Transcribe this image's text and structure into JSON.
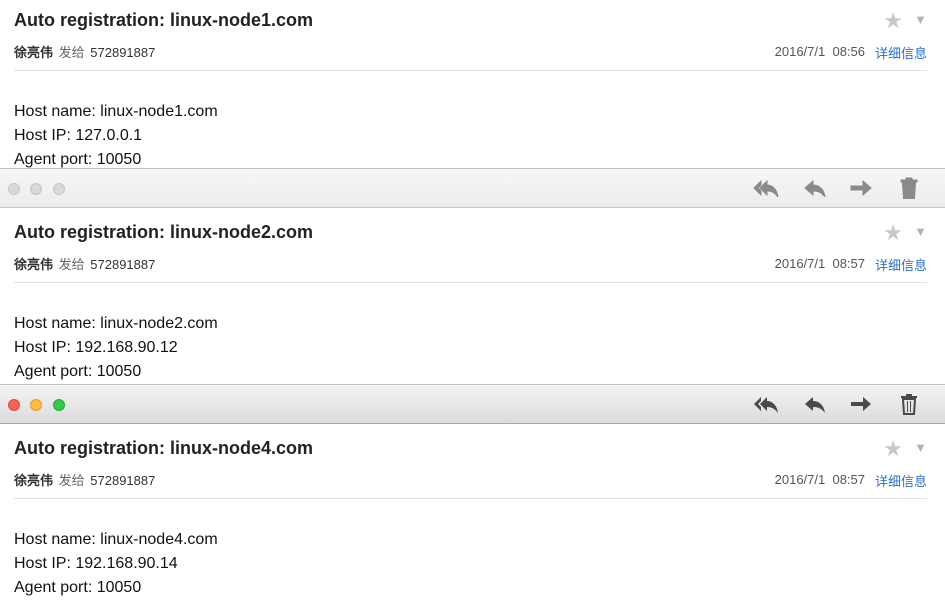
{
  "emails": [
    {
      "subject": "Auto registration: linux-node1.com",
      "sender": "徐亮伟",
      "verb": "发给",
      "recipient": "572891887",
      "date": "2016/7/1  08:56",
      "details_label": "详细信息",
      "lines": [
        "Host name: linux-node1.com",
        "Host IP: 127.0.0.1",
        "Agent port: 10050"
      ]
    },
    {
      "subject": "Auto registration: linux-node2.com",
      "sender": "徐亮伟",
      "verb": "发给",
      "recipient": "572891887",
      "date": "2016/7/1  08:57",
      "details_label": "详细信息",
      "lines": [
        "Host name: linux-node2.com",
        "Host IP: 192.168.90.12",
        "Agent port: 10050"
      ]
    },
    {
      "subject": "Auto registration: linux-node4.com",
      "sender": "徐亮伟",
      "verb": "发给",
      "recipient": "572891887",
      "date": "2016/7/1  08:57",
      "details_label": "详细信息",
      "lines": [
        "Host name: linux-node4.com",
        "Host IP: 192.168.90.14",
        "Agent port: 10050"
      ]
    }
  ],
  "icons": {
    "star": "star-icon",
    "caret": "chevron-down-icon",
    "reply_all": "reply-all-icon",
    "reply": "reply-icon",
    "forward": "forward-icon",
    "trash": "trash-icon"
  },
  "colors": {
    "link": "#2a6fd1",
    "light_close": "#fc605b",
    "light_min": "#fdbc40",
    "light_max": "#34c84a"
  },
  "toolbars": [
    {
      "state": "inactive"
    },
    {
      "state": "active"
    }
  ]
}
